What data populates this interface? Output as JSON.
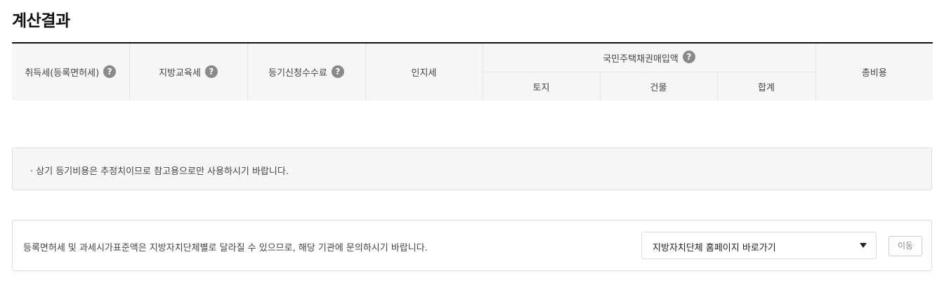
{
  "page": {
    "title": "계산결과"
  },
  "table": {
    "headers": {
      "acquisition_tax": "취득세(등록면허세)",
      "education_tax": "지방교육세",
      "registration_fee": "등기신청수수료",
      "stamp_tax": "인지세",
      "bond_purchase": "국민주택채권매입액",
      "bond_land": "토지",
      "bond_building": "건물",
      "bond_total": "합계",
      "total_cost": "총비용"
    },
    "help_icon": "question-circle-icon",
    "help_glyph": "?"
  },
  "notice": {
    "text": "· 상기 등기비용은 추정치이므로 참고용으로만 사용하시기 바랍니다."
  },
  "info": {
    "text": "등록면허세 및 과세시가표준액은 지방자치단체별로 달라질 수 있으므로, 해당 기관에 문의하시기 바랍니다.",
    "select_value": "지방자치단체 홈페이지 바로가기",
    "go_button": "이동"
  }
}
